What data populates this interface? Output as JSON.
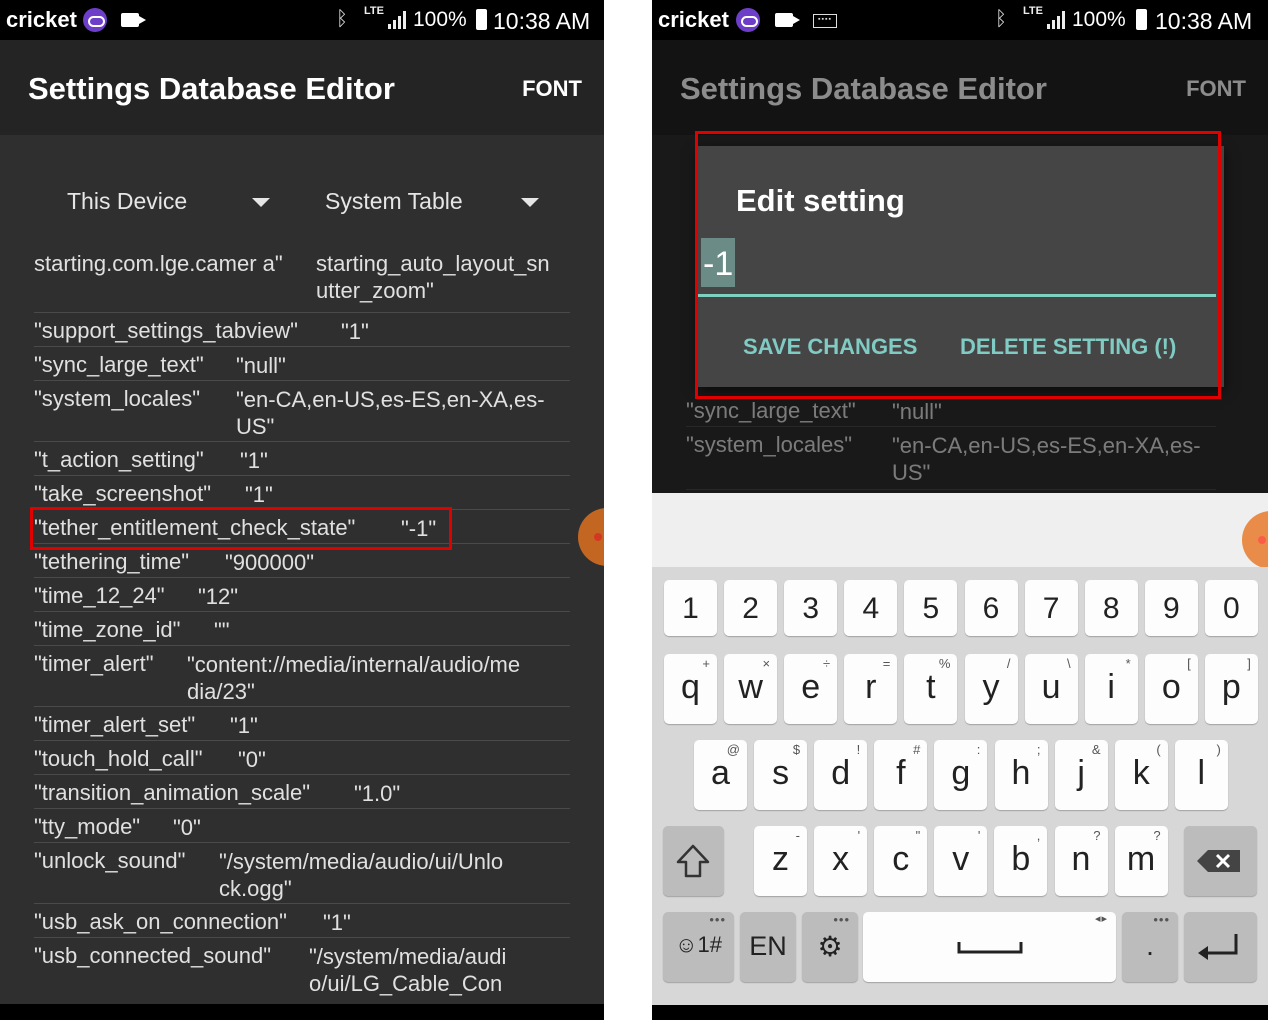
{
  "status": {
    "carrier": "cricket",
    "lte": "LTE",
    "battery": "100%",
    "time": "10:38 AM"
  },
  "app": {
    "title": "Settings Database Editor",
    "font_button": "FONT"
  },
  "spinners": {
    "device": "This Device",
    "table": "System Table"
  },
  "rows": [
    {
      "key": "starting.com.lge.camer a\"",
      "value": "starting_auto_layout_sn utter_zoom\""
    },
    {
      "key": "\"support_settings_tabview\"",
      "value": "\"1\""
    },
    {
      "key": "\"sync_large_text\"",
      "value": "\"null\""
    },
    {
      "key": "\"system_locales\"",
      "value": "\"en-CA,en-US,es-ES,en-XA,es-US\""
    },
    {
      "key": "\"t_action_setting\"",
      "value": "\"1\""
    },
    {
      "key": "\"take_screenshot\"",
      "value": "\"1\""
    },
    {
      "key": "\"tether_entitlement_check_state\"",
      "value": "\"-1\""
    },
    {
      "key": "\"tethering_time\"",
      "value": "\"900000\""
    },
    {
      "key": "\"time_12_24\"",
      "value": "\"12\""
    },
    {
      "key": "\"time_zone_id\"",
      "value": "\"\""
    },
    {
      "key": "\"timer_alert\"",
      "value": "\"content://media/internal/audio/media/23\""
    },
    {
      "key": "\"timer_alert_set\"",
      "value": "\"1\""
    },
    {
      "key": "\"touch_hold_call\"",
      "value": "\"0\""
    },
    {
      "key": "\"transition_animation_scale\"",
      "value": "\"1.0\""
    },
    {
      "key": "\"tty_mode\"",
      "value": "\"0\""
    },
    {
      "key": "\"unlock_sound\"",
      "value": "\"/system/media/audio/ui/Unlock.ogg\""
    },
    {
      "key": "\"usb_ask_on_connection\"",
      "value": "\"1\""
    },
    {
      "key": "\"usb_connected_sound\"",
      "value": "\"/system/media/audio/ui/LG_Cable_Connect.ogg\""
    }
  ],
  "dialog": {
    "title": "Edit setting",
    "value": "-1",
    "save": "SAVE CHANGES",
    "delete": "DELETE SETTING (!)"
  },
  "bg_rows": [
    {
      "key": "\"sync_large_text\"",
      "value": "\"null\""
    },
    {
      "key": "\"system_locales\"",
      "value": "\"en-CA,en-US,es-ES,en-XA,es-US\""
    }
  ],
  "keyboard": {
    "numbers": [
      "1",
      "2",
      "3",
      "4",
      "5",
      "6",
      "7",
      "8",
      "9",
      "0"
    ],
    "row1": [
      {
        "k": "q",
        "s": "+"
      },
      {
        "k": "w",
        "s": "×"
      },
      {
        "k": "e",
        "s": "÷"
      },
      {
        "k": "r",
        "s": "="
      },
      {
        "k": "t",
        "s": "%"
      },
      {
        "k": "y",
        "s": "/"
      },
      {
        "k": "u",
        "s": "\\"
      },
      {
        "k": "i",
        "s": "*"
      },
      {
        "k": "o",
        "s": "["
      },
      {
        "k": "p",
        "s": "]"
      }
    ],
    "row2": [
      {
        "k": "a",
        "s": "@"
      },
      {
        "k": "s",
        "s": "$"
      },
      {
        "k": "d",
        "s": "!"
      },
      {
        "k": "f",
        "s": "#"
      },
      {
        "k": "g",
        "s": ":"
      },
      {
        "k": "h",
        "s": ";"
      },
      {
        "k": "j",
        "s": "&"
      },
      {
        "k": "k",
        "s": "("
      },
      {
        "k": "l",
        "s": ")"
      }
    ],
    "row3": [
      {
        "k": "z",
        "s": "-"
      },
      {
        "k": "x",
        "s": "'"
      },
      {
        "k": "c",
        "s": "\""
      },
      {
        "k": "v",
        "s": "'"
      },
      {
        "k": "b",
        "s": ","
      },
      {
        "k": "n",
        "s": "?"
      },
      {
        "k": "m",
        "s": "?"
      }
    ],
    "symbols_key": "☺1#",
    "lang_key": "EN",
    "period_key": "."
  },
  "colors": {
    "highlight": "#e00000",
    "accent": "#80cbc4"
  }
}
